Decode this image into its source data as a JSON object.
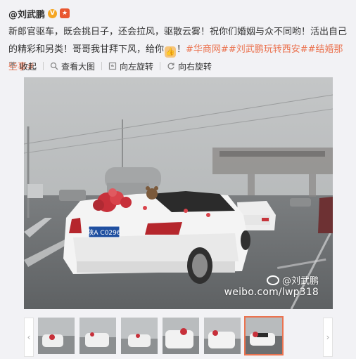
{
  "author": {
    "name": "@刘武鹏",
    "verified_badge": "V"
  },
  "post": {
    "text": "新郎官驱车，既会挑日子，还会拉风，驱散云雾！祝你们婚姻与众不同哟！活出自己的精彩和另类！哥哥我甘拜下风，给你",
    "tail": "！",
    "tags": [
      "#华商网#",
      "#刘武鹏玩转西安#",
      "#结婚那些事#"
    ]
  },
  "toolbar": {
    "collapse": "收起",
    "view_large": "查看大图",
    "rotate_left": "向左旋转",
    "rotate_right": "向右旋转"
  },
  "photo": {
    "watermark_user": "@刘武鹏",
    "watermark_url": "weibo.com/lwp318",
    "plate": "陕A C0296"
  },
  "gallery": {
    "count": 6,
    "active_index": 5
  },
  "colors": {
    "accent": "#eb7350",
    "badge_v": "#f5a623"
  }
}
